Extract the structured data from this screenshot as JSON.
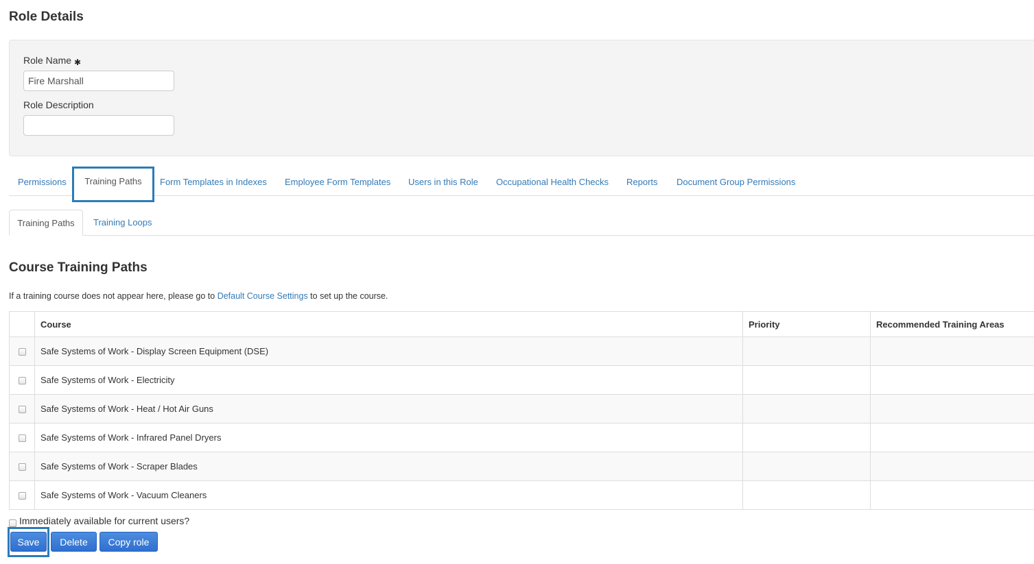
{
  "page": {
    "title": "Role Details"
  },
  "form": {
    "role_name_label": "Role Name",
    "required_mark": "✱",
    "role_name_value": "Fire Marshall",
    "role_description_label": "Role Description",
    "role_description_value": ""
  },
  "tabs": [
    {
      "label": "Permissions",
      "active": false
    },
    {
      "label": "Training Paths",
      "active": true
    },
    {
      "label": "Form Templates in Indexes",
      "active": false
    },
    {
      "label": "Employee Form Templates",
      "active": false
    },
    {
      "label": "Users in this Role",
      "active": false
    },
    {
      "label": "Occupational Health Checks",
      "active": false
    },
    {
      "label": "Reports",
      "active": false
    },
    {
      "label": "Document Group Permissions",
      "active": false
    }
  ],
  "subtabs": [
    {
      "label": "Training Paths",
      "active": true
    },
    {
      "label": "Training Loops",
      "active": false
    }
  ],
  "section": {
    "title": "Course Training Paths",
    "help_prefix": "If a training course does not appear here, please go to ",
    "help_link": "Default Course Settings",
    "help_suffix": " to set up the course."
  },
  "table": {
    "columns": [
      "Course",
      "Priority",
      "Recommended Training Areas"
    ],
    "rows": [
      {
        "course": "Safe Systems of Work - Display Screen Equipment (DSE)",
        "priority": "",
        "areas": ""
      },
      {
        "course": "Safe Systems of Work - Electricity",
        "priority": "",
        "areas": ""
      },
      {
        "course": "Safe Systems of Work - Heat / Hot Air Guns",
        "priority": "",
        "areas": ""
      },
      {
        "course": "Safe Systems of Work - Infrared Panel Dryers",
        "priority": "",
        "areas": ""
      },
      {
        "course": "Safe Systems of Work - Scraper Blades",
        "priority": "",
        "areas": ""
      },
      {
        "course": "Safe Systems of Work - Vacuum Cleaners",
        "priority": "",
        "areas": ""
      }
    ]
  },
  "footer": {
    "available_label": "Immediately available for current users?",
    "save_label": "Save",
    "delete_label": "Delete",
    "copy_label": "Copy role"
  },
  "colors": {
    "link": "#337ab7",
    "button": "#2f6fd0",
    "highlight": "#2b7bb8"
  }
}
